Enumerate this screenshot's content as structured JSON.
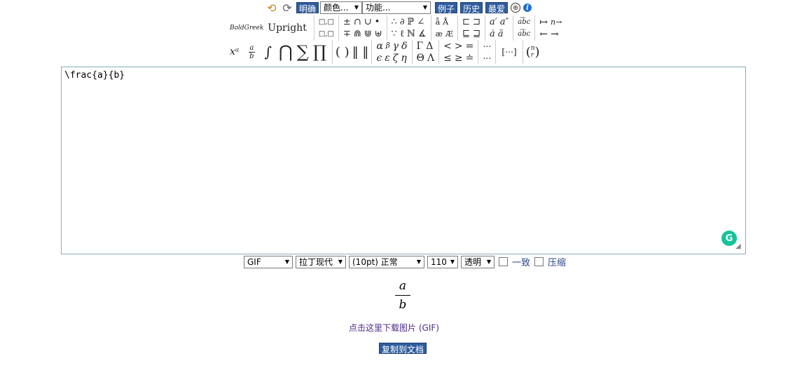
{
  "toolbar": {
    "undo_icon": "undo-icon",
    "redo_icon": "redo-icon",
    "clear_label": "明确",
    "color_select": "颜色...",
    "function_select": "功能...",
    "examples_label": "例子",
    "history_label": "历史",
    "favorites_label": "最爱",
    "add_icon": "⊕",
    "info_icon": "i"
  },
  "symbols": {
    "bold_greek": "BoldGreek",
    "upright": "Upright",
    "boxes_top": "□,□",
    "boxes_bottom": "□,□",
    "ops_top": [
      "±",
      "∩",
      "∪",
      "•"
    ],
    "ops_bottom": [
      "∓",
      "⋒",
      "⋓",
      "⊎"
    ],
    "logic_top": [
      "∴",
      "∂",
      "ℙ",
      "∠"
    ],
    "logic_bottom": [
      "∵",
      "ℓ",
      "ℕ",
      "∡"
    ],
    "accents_top": [
      "å",
      "Å"
    ],
    "accents_bottom": [
      "æ",
      "Æ"
    ],
    "sets_top": [
      "⊏",
      "⊐"
    ],
    "sets_bottom": [
      "⊑",
      "⊒"
    ],
    "primes_top": [
      "a′",
      "a″"
    ],
    "primes_bottom": [
      "ȧ",
      "ä"
    ],
    "arc_top": "a͡bc",
    "arc_bottom": "a͡bc",
    "arrows_top": [
      "↦",
      "n→"
    ],
    "arrows_bottom": [
      "←",
      "→"
    ],
    "row2": {
      "power": "xᵃ",
      "frac_num": "a",
      "frac_den": "b",
      "integral": "∫",
      "bigcap": "⋂",
      "sum": "∑",
      "prod": "∏",
      "parens": "( )",
      "norms": "‖ ‖",
      "greek_top": [
        "α",
        "β",
        "γ",
        "δ"
      ],
      "greek_bottom": [
        "ϵ",
        "ε",
        "ζ",
        "η"
      ],
      "caps_top": [
        "Γ",
        "Δ"
      ],
      "caps_bottom": [
        "Θ",
        "Λ"
      ],
      "rel_top": [
        "<",
        ">",
        "="
      ],
      "rel_bottom": [
        "≤",
        "≥",
        "≐"
      ],
      "dots_top": "⋯",
      "dots_bottom": "⋯",
      "matrix": "[⋯]",
      "binom_top": "n",
      "binom_bottom": "r"
    }
  },
  "editor": {
    "content": "\\frac{a}{b}",
    "grammarly_icon": "G"
  },
  "options": {
    "format": "GIF",
    "font": "拉丁现代",
    "size": "(10pt) 正常",
    "dpi": "110",
    "background": "透明",
    "inline_label": "一致",
    "compress_label": "压缩"
  },
  "preview": {
    "numerator": "a",
    "denominator": "b"
  },
  "download_link": "点击这里下载图片 (GIF)",
  "copy_button": "复制到文档"
}
